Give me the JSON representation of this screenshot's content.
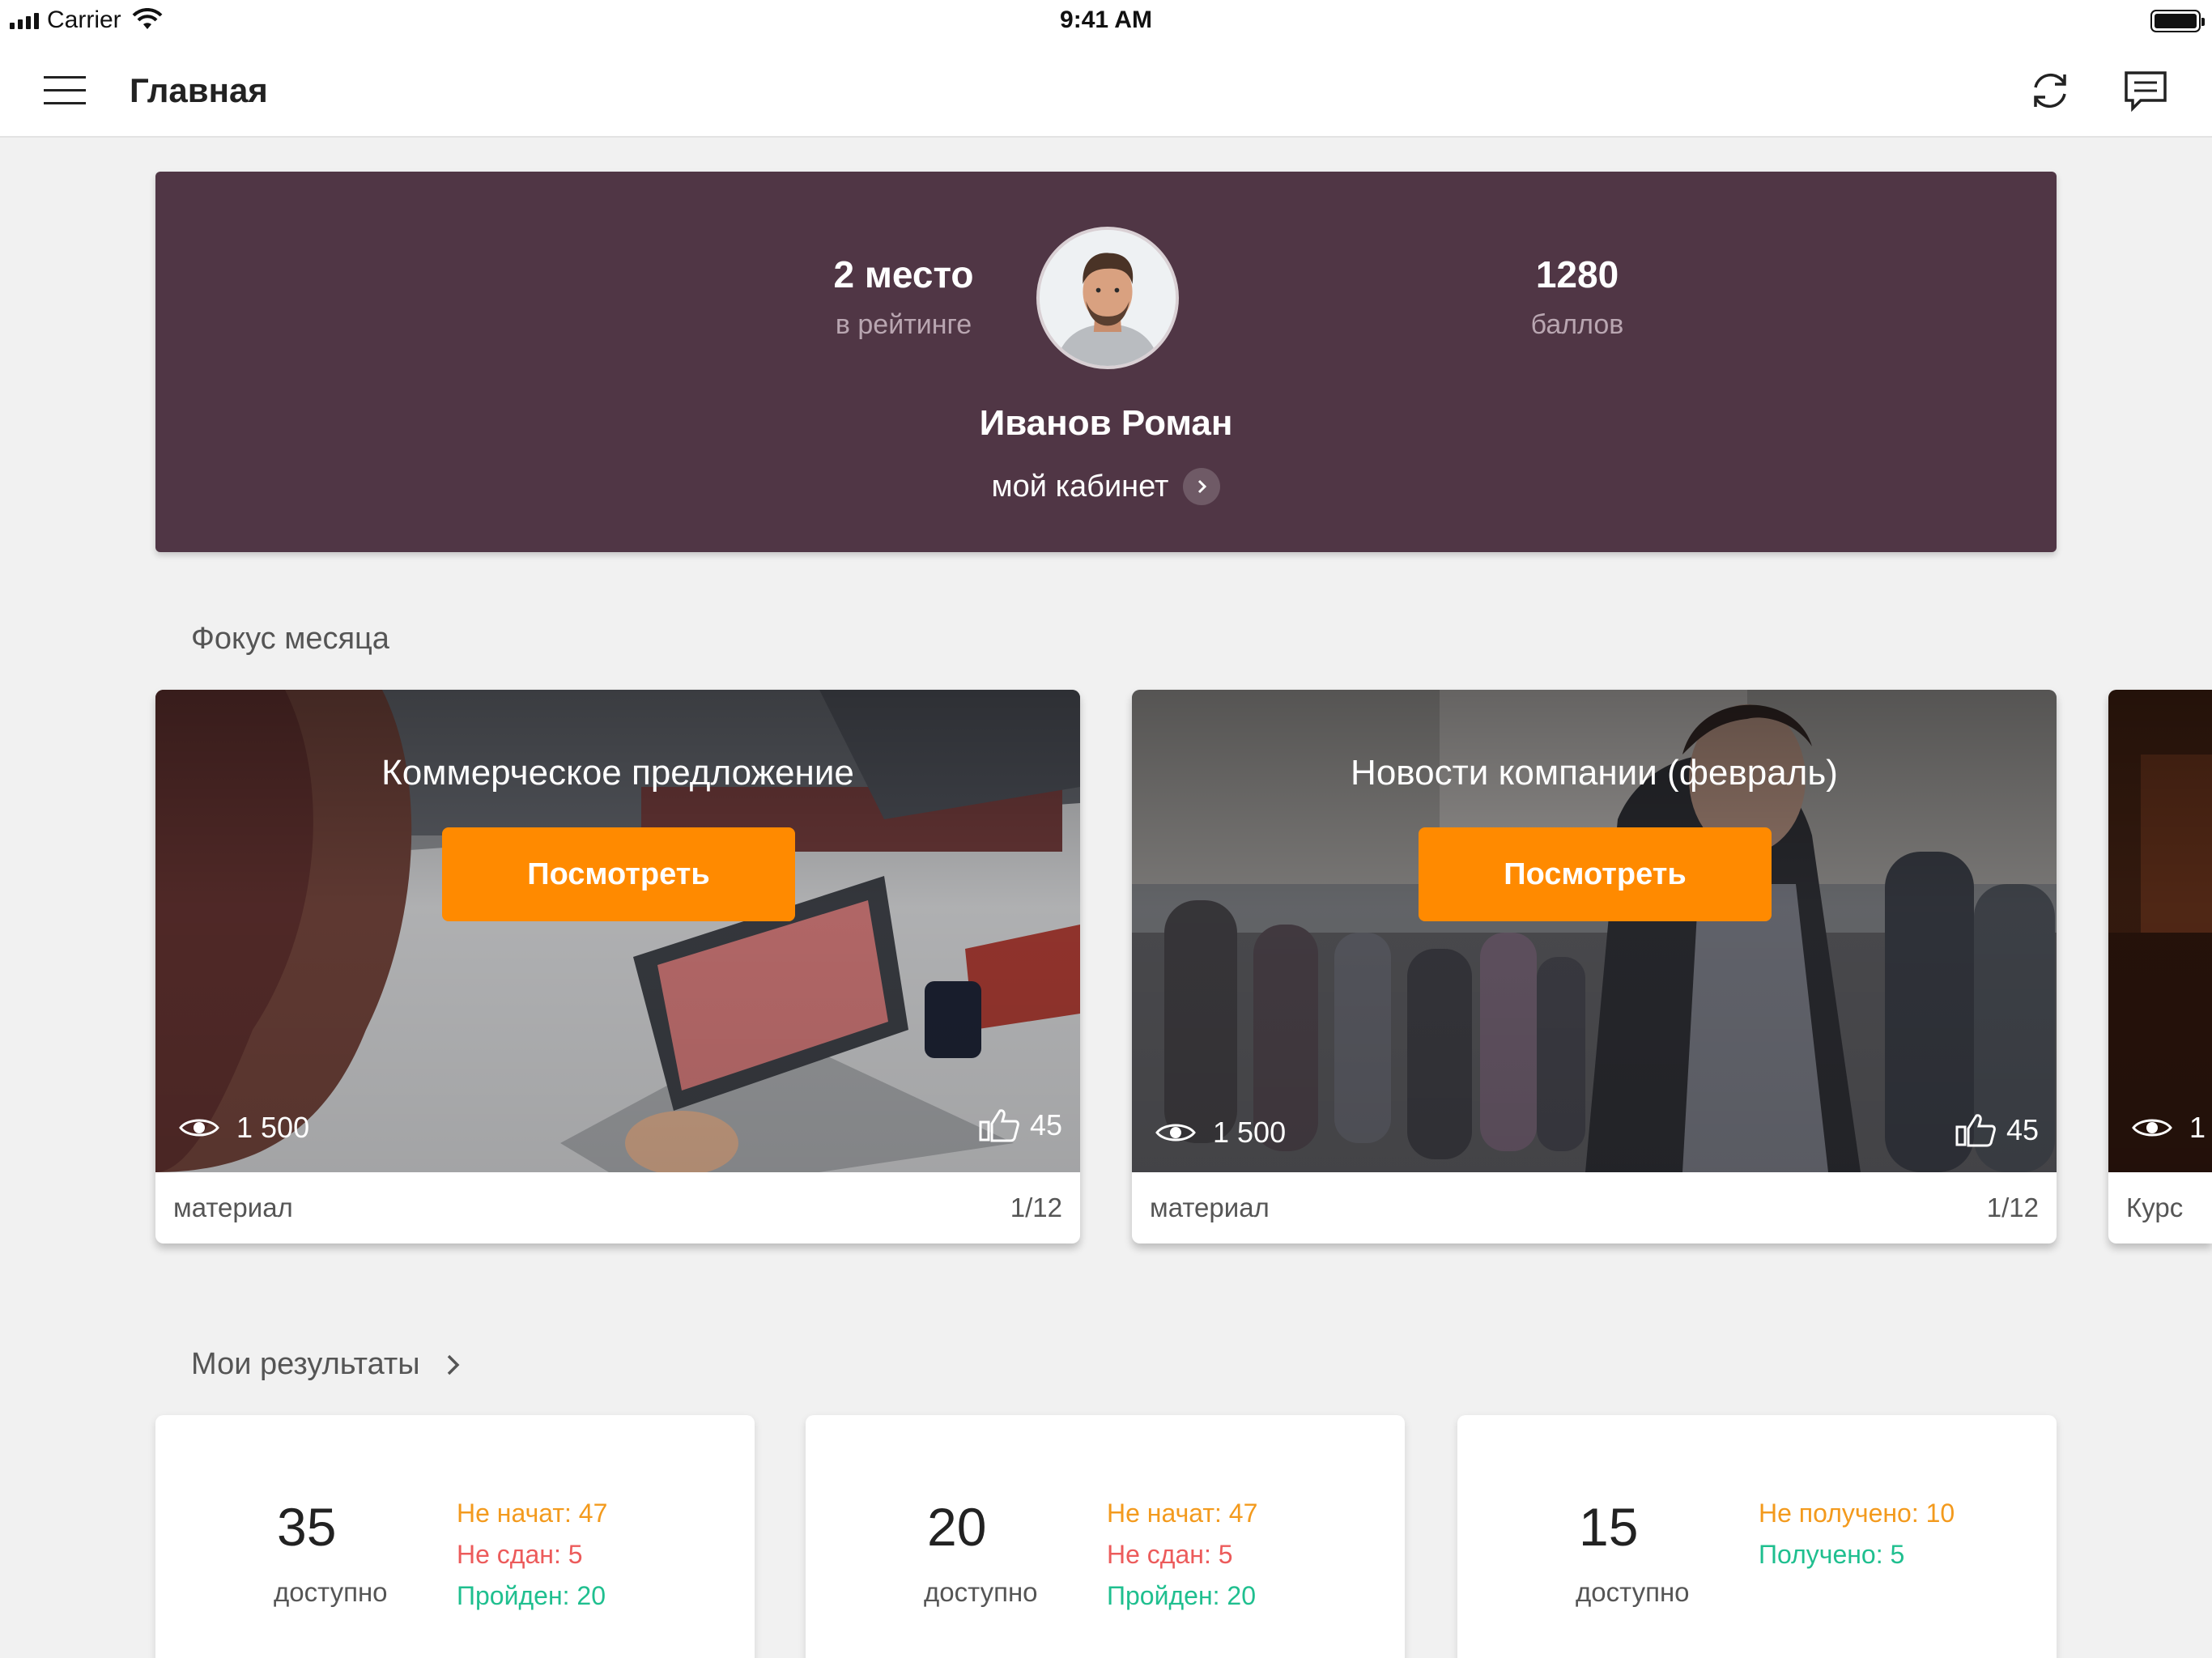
{
  "status_bar": {
    "carrier": "Carrier",
    "time": "9:41 AM"
  },
  "nav": {
    "title": "Главная"
  },
  "profile": {
    "rank": "2 место",
    "rank_caption": "в рейтинге",
    "points": "1280",
    "points_caption": "баллов",
    "name": "Иванов Роман",
    "cabinet_link": "мой кабинет"
  },
  "focus": {
    "section_title": "Фокус месяца",
    "cards": [
      {
        "title": "Коммерческое предложение",
        "button": "Посмотреть",
        "views": "1 500",
        "likes": "45",
        "type": "материал",
        "progress": "1/12"
      },
      {
        "title": "Новости компании (февраль)",
        "button": "Посмотреть",
        "views": "1 500",
        "likes": "45",
        "type": "материал",
        "progress": "1/12"
      },
      {
        "views": "1",
        "type": "Курс"
      }
    ]
  },
  "results": {
    "section_title": "Мои результаты",
    "cards": [
      {
        "count": "35",
        "caption": "доступно",
        "lines": [
          "Не начат: 47",
          "Не сдан: 5",
          "Пройден: 20"
        ]
      },
      {
        "count": "20",
        "caption": "доступно",
        "lines": [
          "Не начат: 47",
          "Не сдан: 5",
          "Пройден: 20"
        ]
      },
      {
        "count": "15",
        "caption": "доступно",
        "lines": [
          "Не получено: 10",
          "Получено: 5"
        ]
      }
    ]
  },
  "colors": {
    "profile_bg": "#503645",
    "accent": "#ff8a00",
    "status_orange": "#f39a1d",
    "status_red": "#ec5b5b",
    "status_green": "#1fbf8f"
  }
}
